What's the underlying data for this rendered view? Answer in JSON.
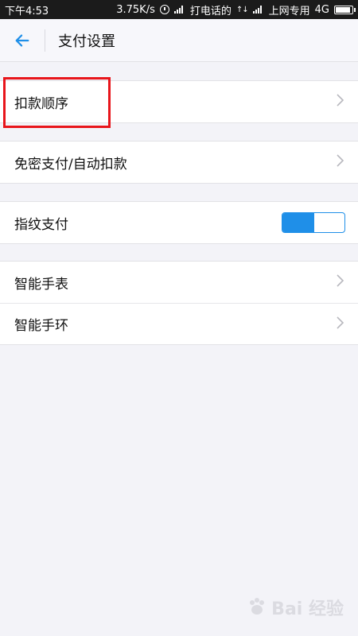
{
  "status_bar": {
    "time": "下午4:53",
    "speed": "3.75K/s",
    "call_status": "打电话的",
    "carrier": "上网专用",
    "network": "4G"
  },
  "header": {
    "title": "支付设置",
    "back_icon": "arrow-left-icon"
  },
  "settings": {
    "group1": {
      "item1": {
        "label": "扣款顺序"
      }
    },
    "group2": {
      "item1": {
        "label": "免密支付/自动扣款"
      }
    },
    "group3": {
      "item1": {
        "label": "指纹支付",
        "toggle_on": true
      }
    },
    "group4": {
      "item1": {
        "label": "智能手表"
      },
      "item2": {
        "label": "智能手环"
      }
    }
  },
  "colors": {
    "accent": "#1f8fe8",
    "highlight": "#e8151b",
    "background": "#f3f3f8"
  },
  "watermark": {
    "text": "Bai 经验"
  }
}
